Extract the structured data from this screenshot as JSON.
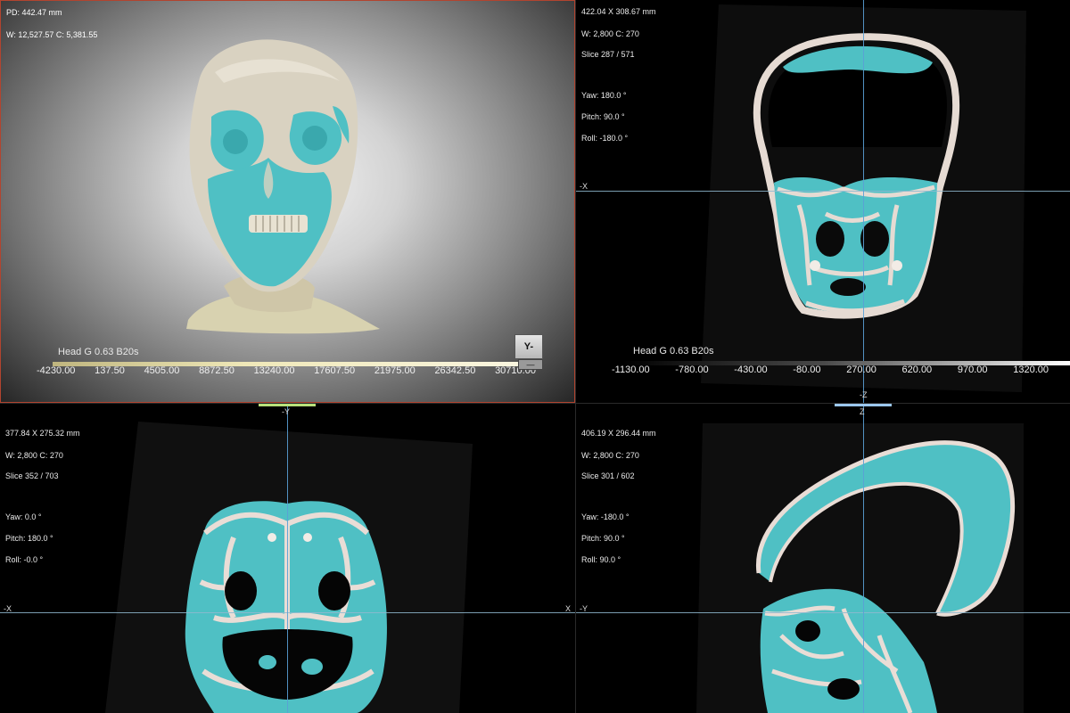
{
  "viewport_3d": {
    "pd": "PD: 442.47 mm",
    "window": "W: 12,527.57 C: 5,381.55",
    "series": "Head  G 0.63  B20s",
    "ticks": [
      "-4230.00",
      "137.50",
      "4505.00",
      "8872.50",
      "13240.00",
      "17607.50",
      "21975.00",
      "26342.50",
      "30710.00"
    ],
    "orientation_face": "Y-",
    "orientation_bottom": "—"
  },
  "viewport_coronal": {
    "size": "422.04 X 308.67 mm",
    "window": "W: 2,800 C: 270",
    "slice": "Slice 287 / 571",
    "yaw": "Yaw: 180.0 °",
    "pitch": "Pitch: 90.0 °",
    "roll": "Roll: -180.0 °",
    "left_axis": "-X",
    "bottom_axis": "-Z",
    "series": "Head  G 0.63  B20s",
    "ticks": [
      "-1130.00",
      "-780.00",
      "-430.00",
      "-80.00",
      "270.00",
      "620.00",
      "970.00",
      "1320.00"
    ]
  },
  "viewport_axial": {
    "size": "377.84 X 275.32 mm",
    "window": "W: 2,800 C: 270",
    "slice": "Slice 352 / 703",
    "yaw": "Yaw: 0.0 °",
    "pitch": "Pitch: 180.0 °",
    "roll": "Roll: -0.0 °",
    "top_axis": "-Y",
    "left_axis": "-X",
    "right_axis": "X"
  },
  "viewport_sagittal": {
    "size": "406.19 X 296.44 mm",
    "window": "W: 2,800 C: 270",
    "slice": "Slice 301 / 602",
    "yaw": "Yaw: -180.0 °",
    "pitch": "Pitch: 90.0 °",
    "roll": "Roll: 90.0 °",
    "top_axis": "Z",
    "left_axis": "-Y"
  },
  "colors": {
    "bone": "#e9ddd6",
    "soft_tissue": "#4fc0c4",
    "skin_3d": "#d8d2bd",
    "crosshair": "#8fb8cf",
    "active_border": "#b2442f"
  }
}
